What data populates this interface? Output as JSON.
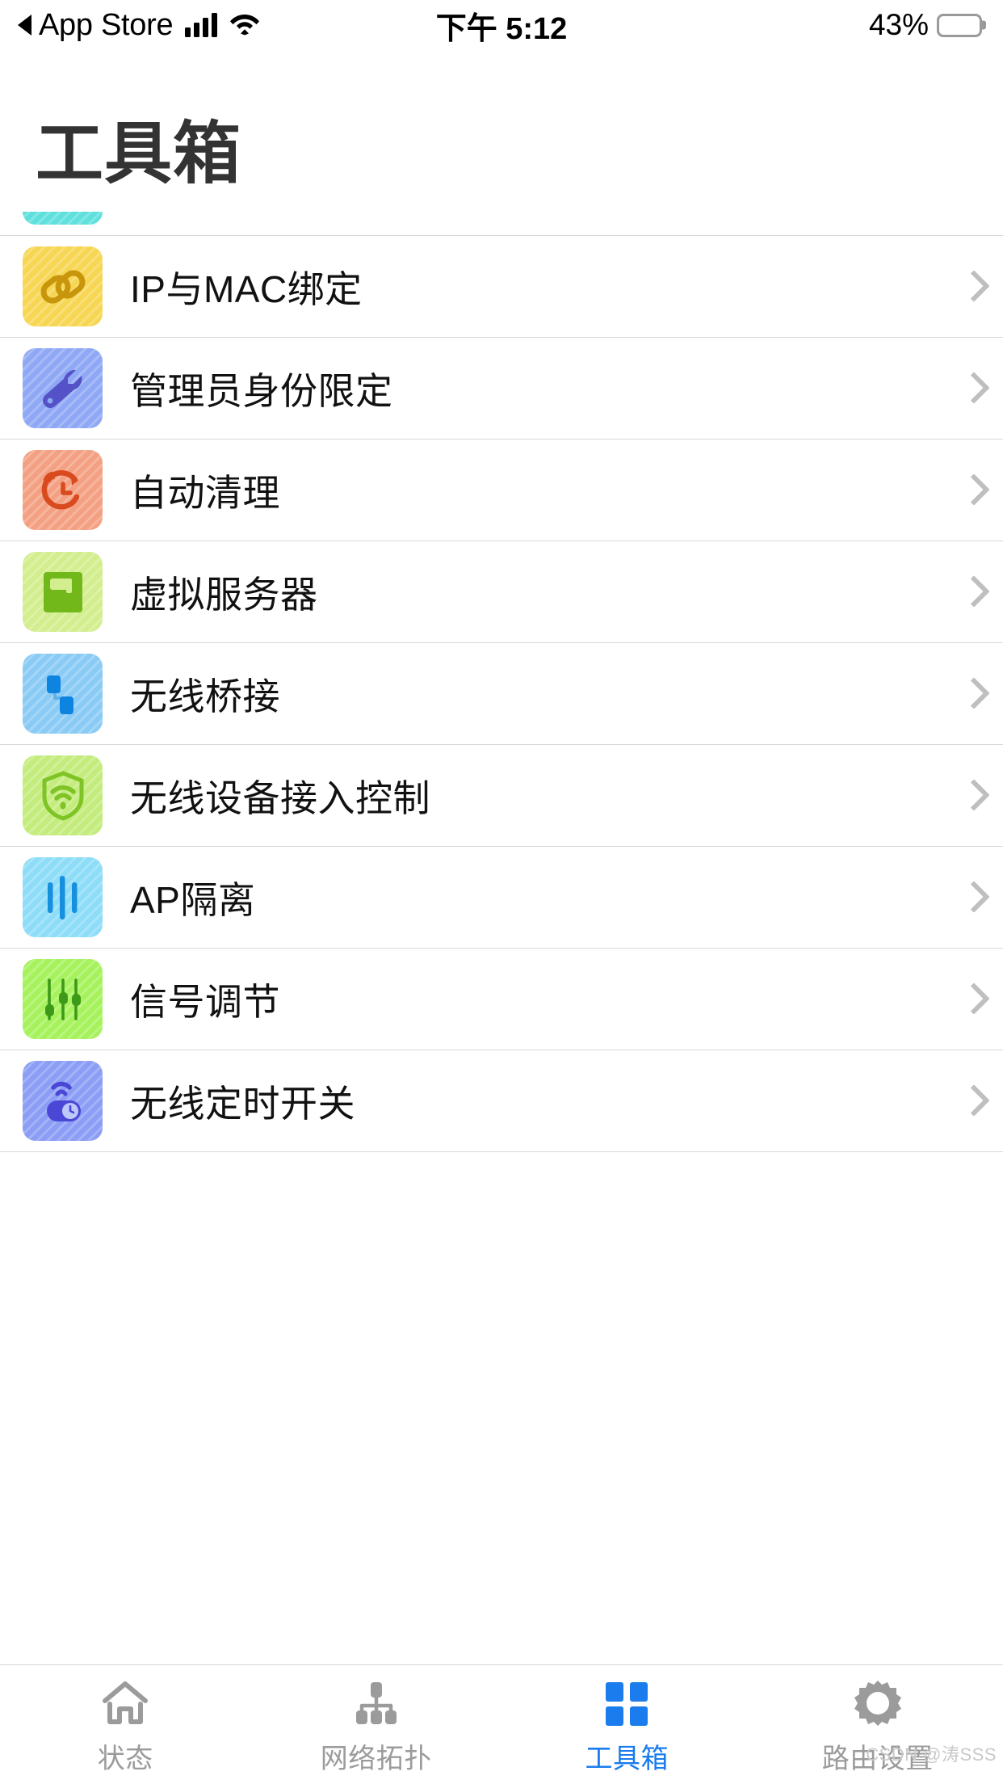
{
  "status_bar": {
    "back_label": "App Store",
    "back_icon": "back-triangle-icon",
    "signal_icon": "cellular-signal-icon",
    "wifi_icon": "wifi-icon",
    "time": "下午 5:12",
    "battery_percent": "43%",
    "battery_icon": "battery-icon",
    "battery_fill_pct": 43,
    "battery_color": "#FFD60A"
  },
  "header": {
    "title": "工具箱"
  },
  "list": {
    "partial_top_item": {
      "label": "",
      "icon": "turquoise-partial-icon",
      "bg": "#5FE0DD",
      "fg": "#19B8B3"
    },
    "items": [
      {
        "label": "IP与MAC绑定",
        "icon": "chain-link-icon",
        "bg": "#F7D653",
        "fg": "#C8960C",
        "chevron": "chevron-right-icon"
      },
      {
        "label": "管理员身份限定",
        "icon": "wrench-icon",
        "bg": "#8FA8F5",
        "fg": "#5552C8",
        "chevron": "chevron-right-icon"
      },
      {
        "label": "自动清理",
        "icon": "clock-refresh-icon",
        "bg": "#F4A083",
        "fg": "#D94A1E",
        "chevron": "chevron-right-icon"
      },
      {
        "label": "虚拟服务器",
        "icon": "server-icon",
        "bg": "#D3EE8E",
        "fg": "#72B81B",
        "chevron": "chevron-right-icon"
      },
      {
        "label": "无线桥接",
        "icon": "bridge-nodes-icon",
        "bg": "#8ACBF5",
        "fg": "#0D84E0",
        "chevron": "chevron-right-icon"
      },
      {
        "label": "无线设备接入控制",
        "icon": "shield-wifi-icon",
        "bg": "#C3EC7D",
        "fg": "#7FC326",
        "chevron": "chevron-right-icon"
      },
      {
        "label": "AP隔离",
        "icon": "bars-isolation-icon",
        "bg": "#8EDDF8",
        "fg": "#1590DE",
        "chevron": "chevron-right-icon"
      },
      {
        "label": "信号调节",
        "icon": "sliders-icon",
        "bg": "#A6F25C",
        "fg": "#3D9A18",
        "chevron": "chevron-right-icon"
      },
      {
        "label": "无线定时开关",
        "icon": "wifi-timer-switch-icon",
        "bg": "#8B9DF5",
        "fg": "#4A47D6",
        "chevron": "chevron-right-icon"
      }
    ]
  },
  "tab_bar": {
    "active_color": "#1a7ced",
    "inactive_color": "#9b9b9b",
    "tabs": [
      {
        "label": "状态",
        "icon": "home-icon",
        "active": false
      },
      {
        "label": "网络拓扑",
        "icon": "network-topology-icon",
        "active": false
      },
      {
        "label": "工具箱",
        "icon": "grid-toolbox-icon",
        "active": true
      },
      {
        "label": "路由设置",
        "icon": "gear-icon",
        "active": false
      }
    ]
  },
  "watermark": {
    "text": "CSDN @涛SSS"
  }
}
